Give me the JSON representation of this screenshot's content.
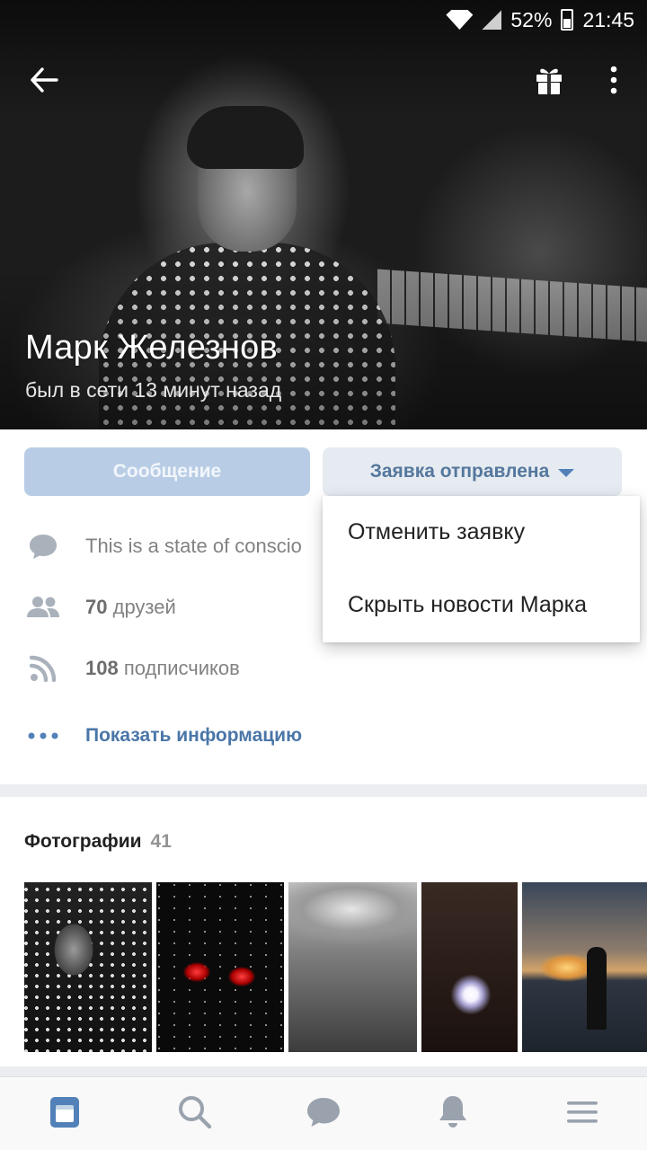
{
  "status_bar": {
    "battery": "52%",
    "time": "21:45"
  },
  "profile": {
    "name": "Марк Железнов",
    "last_seen": "был в сети 13 минут назад"
  },
  "actions": {
    "message_label": "Сообщение",
    "request_label": "Заявка отправлена"
  },
  "dropdown": {
    "items": [
      {
        "label": "Отменить заявку"
      },
      {
        "label": "Скрыть новости Марка"
      }
    ]
  },
  "info": {
    "status_text": "This is a state of conscio",
    "friends_count": "70",
    "friends_label": "друзей",
    "followers_count": "108",
    "followers_label": "подписчиков",
    "show_info_label": "Показать информацию"
  },
  "photos": {
    "title": "Фотографии",
    "count": "41"
  },
  "icons": {
    "back": "arrow-left-icon",
    "gift": "gift-icon",
    "more": "more-vertical-icon",
    "status": "speech-bubble-icon",
    "friends": "people-icon",
    "followers": "rss-icon",
    "info": "dots-icon"
  },
  "colors": {
    "accent": "#4a76a8",
    "message_button_bg": "#b8cde5",
    "request_button_bg": "#e5ebf1",
    "caret": "#5181b8",
    "tab_active": "#5181b8",
    "tab_inactive": "#99a2ad"
  },
  "tabbar": {
    "tabs": [
      "news-icon",
      "search-icon",
      "messages-icon",
      "notifications-icon",
      "menu-icon"
    ],
    "active": "news-icon"
  }
}
